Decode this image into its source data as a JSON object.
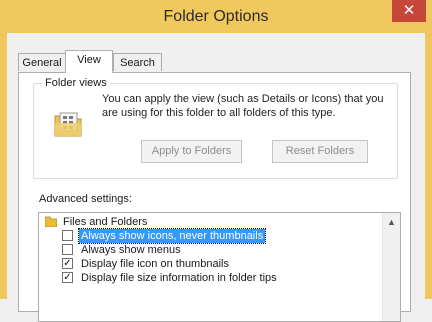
{
  "window": {
    "title": "Folder Options",
    "close_label": "✕"
  },
  "tabs": [
    {
      "label": "General"
    },
    {
      "label": "View"
    },
    {
      "label": "Search"
    }
  ],
  "folder_views": {
    "label": "Folder views",
    "description": "You can apply the view (such as Details or Icons) that you are using for this folder to all folders of this type.",
    "apply_button": "Apply to Folders",
    "reset_button": "Reset Folders"
  },
  "advanced": {
    "label": "Advanced settings:",
    "items": [
      {
        "text": "Files and Folders",
        "type": "folder"
      },
      {
        "text": "Always show icons, never thumbnails",
        "checked": false,
        "selected": true
      },
      {
        "text": "Always show menus",
        "checked": false
      },
      {
        "text": "Display file icon on thumbnails",
        "checked": true
      },
      {
        "text": "Display file size information in folder tips",
        "checked": true
      }
    ]
  },
  "colors": {
    "titlebar": "#f1c85d",
    "close": "#c7463a",
    "selection": "#3399ff"
  }
}
